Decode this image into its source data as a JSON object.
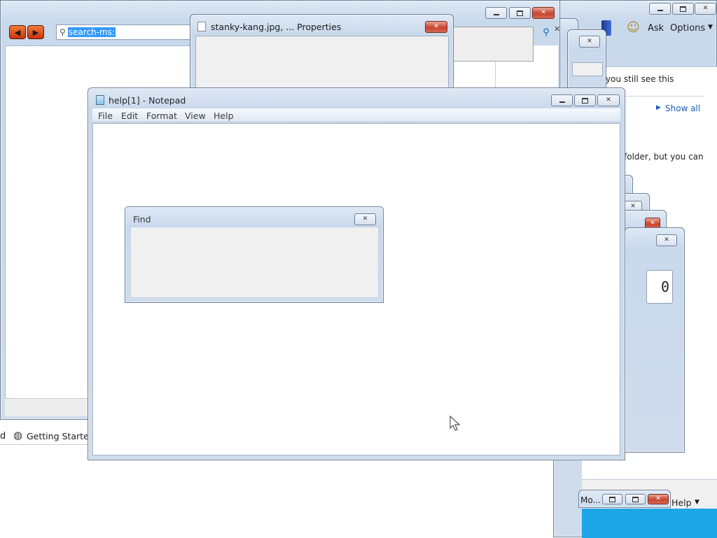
{
  "explorer": {
    "search_text": "search-ms:",
    "favorites_item": "Getting Started",
    "favorites_prefix": "d"
  },
  "help_pane": {
    "ask_label": "Ask",
    "options_label": "Options",
    "snippet_1": "you still see this",
    "show_all": "Show all",
    "snippet_2": "folder, but you can",
    "help_menu": "Help",
    "mo_label": "Mo..."
  },
  "properties_window": {
    "title": "stanky-kang.jpg, ... Properties"
  },
  "calculator": {
    "display_value": "0"
  },
  "notepad": {
    "title": "help[1] - Notepad",
    "menu": [
      "File",
      "Edit",
      "Format",
      "View",
      "Help"
    ]
  },
  "find_dialog": {
    "title": "Find"
  },
  "colors": {
    "accent_blue": "#1a5fb4",
    "selection": "#3399ff",
    "close_red": "#c7432e",
    "wallpaper_blue": "#1ca6e6"
  }
}
